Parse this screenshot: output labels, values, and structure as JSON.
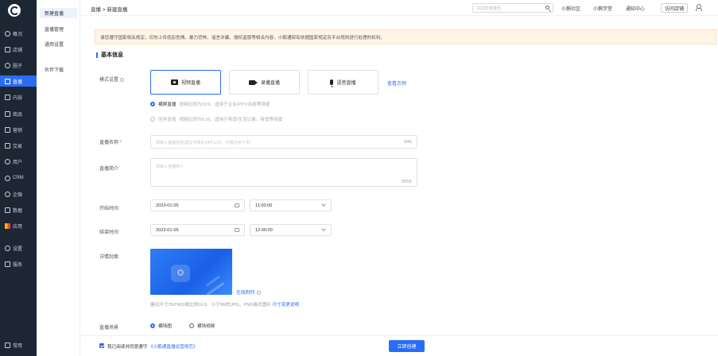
{
  "sidebar": {
    "items": [
      {
        "label": "概况",
        "icon": "dashboard-icon"
      },
      {
        "label": "店铺",
        "icon": "store-icon"
      },
      {
        "label": "圈子",
        "icon": "circle-icon"
      },
      {
        "label": "直播",
        "icon": "live-icon"
      },
      {
        "label": "内容",
        "icon": "content-icon"
      },
      {
        "label": "商品",
        "icon": "goods-icon"
      },
      {
        "label": "营销",
        "icon": "marketing-icon"
      },
      {
        "label": "交易",
        "icon": "trade-icon"
      },
      {
        "label": "用户",
        "icon": "user-icon"
      },
      {
        "label": "CRM",
        "icon": "crm-icon"
      },
      {
        "label": "企微",
        "icon": "wecom-icon"
      },
      {
        "label": "数据",
        "icon": "data-icon"
      },
      {
        "label": "应用",
        "icon": "apps-icon"
      },
      {
        "label": "设置",
        "icon": "settings-icon"
      },
      {
        "label": "服务",
        "icon": "service-icon"
      }
    ],
    "bottom": "常用"
  },
  "subnav": {
    "items": [
      "新建直播",
      "直播管理",
      "通用设置",
      "伙伴下载"
    ]
  },
  "topbar": {
    "breadcrumb": "直播 > 新建直播",
    "search_placeholder": "2023年度报告",
    "links": [
      "小鹅社区",
      "小鹅学堂",
      "通知中心"
    ],
    "shop_button": "访问店铺"
  },
  "notice": "请您遵守国家相关规定，切勿上传低俗色情、暴力恐怖、谣言诈骗、侵权盗版等相关内容，小鹅通保有依据国家规定及平台规则进行处理的权利。",
  "form": {
    "section_title": "基本信息",
    "mode_label": "模式设置",
    "modes": [
      "视频直播",
      "录播直播",
      "语音直播"
    ],
    "view_example": "查看示例",
    "orientations": [
      {
        "label": "横屏直播",
        "desc": "视频比例为16:9，适用于企业/PPT/讲座等场景"
      },
      {
        "label": "竖屏直播",
        "desc": "视频比例为9:16，适用于带货/生活记录，带货等场景"
      }
    ],
    "name_label": "直播名称",
    "name_placeholder": "请输入直播名称(建议字数在14字以内，不超过45个字)",
    "name_counter": "0/45",
    "intro_label": "直播简介",
    "intro_placeholder": "请输入直播简介",
    "intro_counter": "0/250",
    "start_label": "开始时间",
    "start_date": "2023-01-05",
    "start_time": "11:00:00",
    "end_label": "结束时间",
    "end_date": "2023-01-05",
    "end_time": "12:00:00",
    "cover_label": "详情封面",
    "online_design": "在线制作",
    "cover_hint": "建议尺寸750*420或比例16:9，小于5M的JPG、PNG格式图片",
    "cover_size_link": "尺寸变更说明",
    "scene_label": "直播场景",
    "scene_options": [
      "横场图",
      "横场视频"
    ]
  },
  "footer": {
    "agree_text": "我已阅读并同意遵守",
    "agree_link": "《小鹅通直播运营规范》",
    "submit": "立即创建"
  },
  "colors": {
    "accent": "#2a6cf6",
    "sidebar": "#1d2734",
    "notice_bg": "#fff4e5"
  }
}
